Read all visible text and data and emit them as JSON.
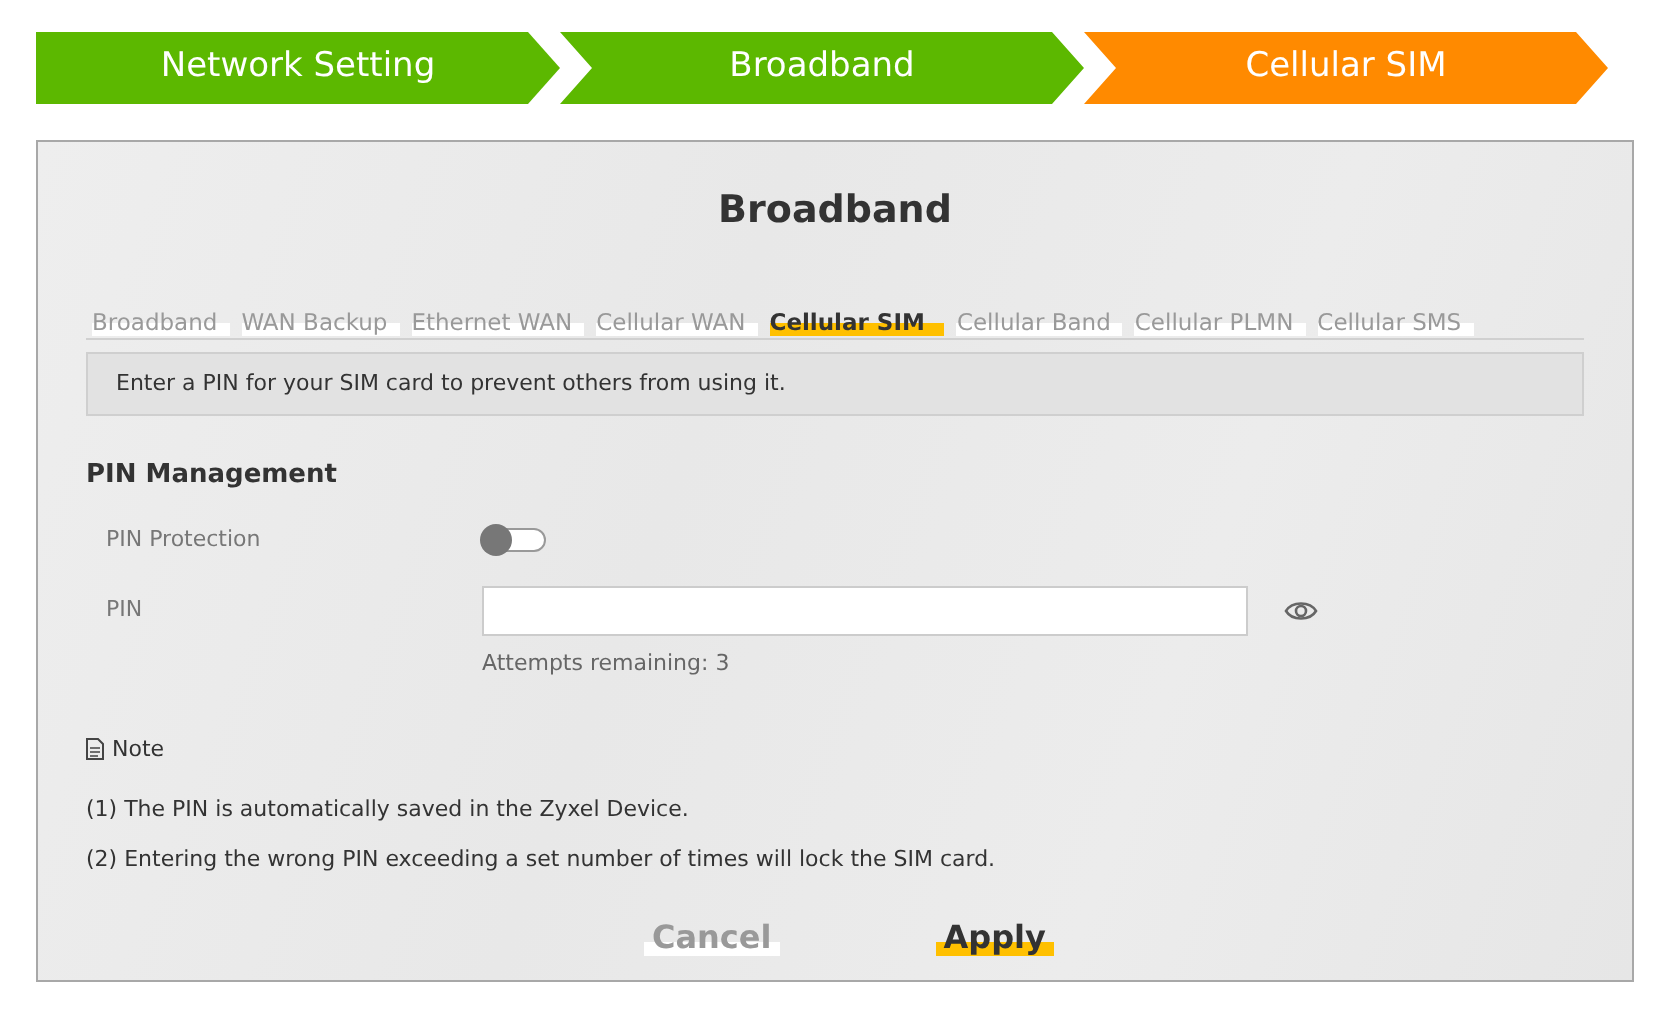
{
  "steps": [
    {
      "label": "Network Setting",
      "selected": false
    },
    {
      "label": "Broadband",
      "selected": false
    },
    {
      "label": "Cellular SIM",
      "selected": true
    }
  ],
  "panel": {
    "title": "Broadband",
    "tabs": [
      {
        "label": "Broadband",
        "selected": false
      },
      {
        "label": "WAN Backup",
        "selected": false
      },
      {
        "label": "Ethernet WAN",
        "selected": false
      },
      {
        "label": "Cellular WAN",
        "selected": false
      },
      {
        "label": "Cellular SIM",
        "selected": true
      },
      {
        "label": "Cellular Band",
        "selected": false
      },
      {
        "label": "Cellular PLMN",
        "selected": false
      },
      {
        "label": "Cellular SMS",
        "selected": false
      }
    ],
    "info": "Enter a PIN for your SIM card to prevent others from using it.",
    "section": "PIN Management",
    "pin_protection": {
      "label": "PIN Protection",
      "on": false
    },
    "pin": {
      "label": "PIN",
      "hint": "Attempts remaining: 3"
    },
    "note": {
      "title": "Note",
      "lines": [
        "(1) The PIN is automatically saved in the Zyxel Device.",
        "(2) Entering the wrong PIN exceeding a set number of times will lock the SIM card."
      ]
    },
    "buttons": [
      {
        "label": "Cancel",
        "kind": "secondary"
      },
      {
        "label": "Apply",
        "kind": "primary"
      }
    ]
  }
}
